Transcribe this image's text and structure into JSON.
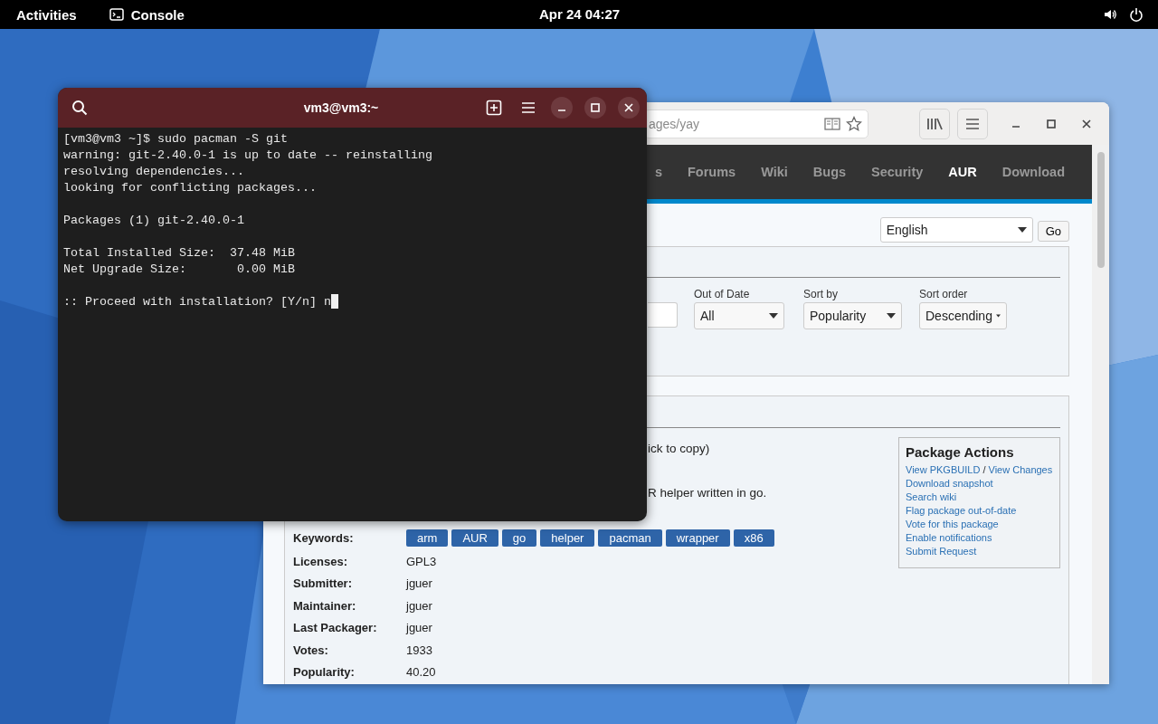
{
  "top_bar": {
    "activities": "Activities",
    "app": "Console",
    "clock": "Apr 24 04:27"
  },
  "terminal": {
    "title": "vm3@vm3:~",
    "blocks": [
      [
        "[vm3@vm3 ~]$ sudo pacman -S git",
        "warning: git-2.40.0-1 is up to date -- reinstalling",
        "resolving dependencies...",
        "looking for conflicting packages..."
      ],
      [
        "Packages (1) git-2.40.0-1"
      ],
      [
        "Total Installed Size:  37.48 MiB",
        "Net Upgrade Size:       0.00 MiB"
      ],
      [
        ":: Proceed with installation? [Y/n] n"
      ]
    ]
  },
  "browser": {
    "url": "ages/yay",
    "nav": [
      {
        "label": "s",
        "selected": false
      },
      {
        "label": "Forums",
        "selected": false
      },
      {
        "label": "Wiki",
        "selected": false
      },
      {
        "label": "Bugs",
        "selected": false
      },
      {
        "label": "Security",
        "selected": false
      },
      {
        "label": "AUR",
        "selected": true
      },
      {
        "label": "Download",
        "selected": false
      }
    ],
    "language": "English",
    "go_button": "Go",
    "filters": [
      {
        "label": "Out of Date",
        "value": "All"
      },
      {
        "label": "Sort by",
        "value": "Popularity"
      },
      {
        "label": "Sort order",
        "value": "Descending"
      }
    ],
    "details": {
      "copy_hint": "ick to copy)",
      "description": "R helper written in go.",
      "keywords_label": "Keywords:",
      "keywords": [
        "arm",
        "AUR",
        "go",
        "helper",
        "pacman",
        "wrapper",
        "x86"
      ],
      "fields": [
        {
          "label": "Licenses:",
          "value": "GPL3"
        },
        {
          "label": "Submitter:",
          "value": "jguer"
        },
        {
          "label": "Maintainer:",
          "value": "jguer"
        },
        {
          "label": "Last Packager:",
          "value": "jguer"
        },
        {
          "label": "Votes:",
          "value": "1933"
        },
        {
          "label": "Popularity:",
          "value": "40.20"
        }
      ]
    },
    "actions": {
      "title": "Package Actions",
      "lines": [
        {
          "links": [
            "View PKGBUILD",
            "View Changes"
          ],
          "separator": "/"
        },
        {
          "links": [
            "Download snapshot"
          ]
        },
        {
          "links": [
            "Search wiki"
          ]
        },
        {
          "links": [
            "Flag package out-of-date"
          ]
        },
        {
          "links": [
            "Vote for this package"
          ]
        },
        {
          "links": [
            "Enable notifications"
          ]
        },
        {
          "links": [
            "Submit Request"
          ]
        }
      ]
    }
  }
}
